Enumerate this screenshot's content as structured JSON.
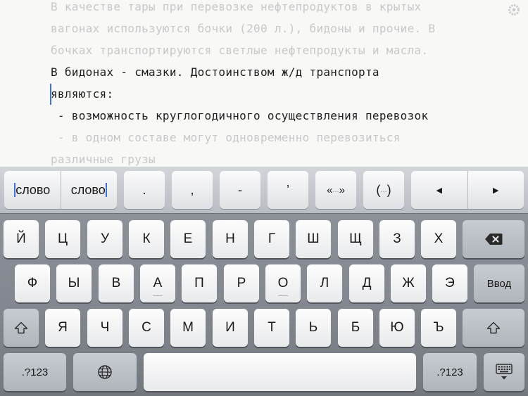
{
  "editor": {
    "lines": [
      "В качестве тары при перевозке нефтепродуктов в крытых",
      "вагонах используются бочки (200 л.), бидоны и прочие. В",
      "бочках транспортируются светлые нефтепродукты и масла.",
      "В бидонах - смазки. Достоинством ж/д транспорта",
      "являются:",
      " - возможность круглогодичного осуществления перевозок",
      " - в одном составе могут одновременно перевозиться",
      "различные грузы"
    ]
  },
  "shortcut_bar": {
    "word_left": "слово",
    "word_right": "слово",
    "period": ".",
    "comma": ",",
    "dash": "-",
    "apostrophe": "’",
    "quotes_open": "«",
    "quotes_dots": "...",
    "quotes_close": "»",
    "paren_open": "(",
    "paren_dots": "...",
    "paren_close": ")",
    "left_arrow": "◀",
    "right_arrow": "▶"
  },
  "keyboard": {
    "row1": [
      "Й",
      "Ц",
      "У",
      "К",
      "Е",
      "Н",
      "Г",
      "Ш",
      "Щ",
      "З",
      "Х"
    ],
    "row2": [
      "Ф",
      "Ы",
      "В",
      "А",
      "П",
      "Р",
      "О",
      "Л",
      "Д",
      "Ж",
      "Э"
    ],
    "row3": [
      "Я",
      "Ч",
      "С",
      "М",
      "И",
      "Т",
      "Ь",
      "Б",
      "Ю",
      "Ъ"
    ],
    "return_label": "Ввод",
    "numbers_left": ".?123",
    "numbers_right": ".?123"
  },
  "icons": {
    "backspace": "backspace-icon",
    "shift": "shift-icon",
    "globe": "globe-icon",
    "hide_keyboard": "hide-keyboard-icon",
    "settings": "settings-icon"
  },
  "colors": {
    "caret": "#3d6fe0",
    "active_text": "#1e1e1e",
    "dim_text": "#c8c8c8"
  }
}
